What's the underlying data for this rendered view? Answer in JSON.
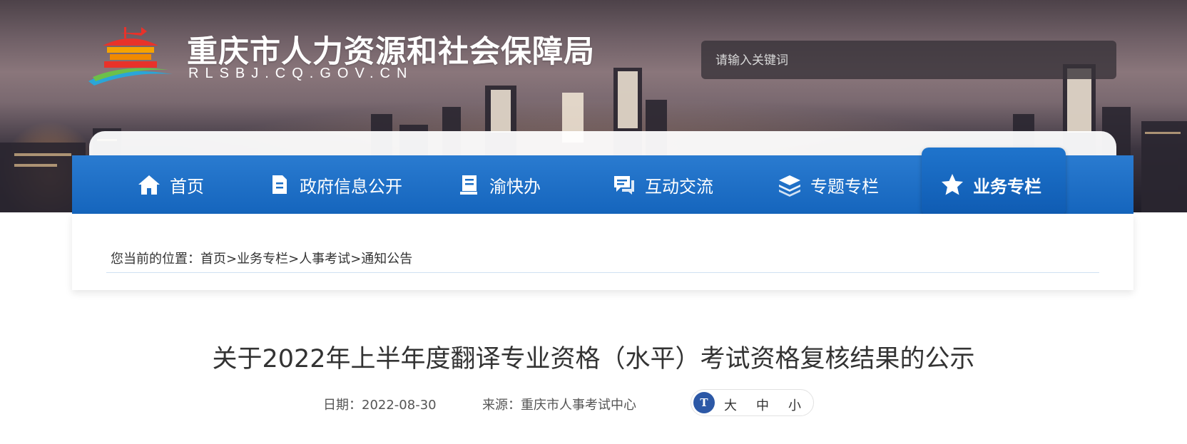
{
  "header": {
    "site_title": "重庆市人力资源和社会保障局",
    "site_domain": "RLSBJ.CQ.GOV.CN",
    "search_placeholder": "请输入关键词"
  },
  "nav": {
    "items": [
      {
        "label": "首页",
        "icon": "home-icon"
      },
      {
        "label": "政府信息公开",
        "icon": "document-icon"
      },
      {
        "label": "渝快办",
        "icon": "book-icon"
      },
      {
        "label": "互动交流",
        "icon": "chat-icon"
      },
      {
        "label": "专题专栏",
        "icon": "layers-icon"
      },
      {
        "label": "业务专栏",
        "icon": "star-icon",
        "active": true
      }
    ]
  },
  "breadcrumb": {
    "prefix": "您当前的位置：",
    "items": [
      "首页",
      "业务专栏",
      "人事考试",
      "通知公告"
    ],
    "separator": ">"
  },
  "article": {
    "title": "关于2022年上半年度翻译专业资格（水平）考试资格复核结果的公示",
    "date_label": "日期：",
    "date": "2022-08-30",
    "source_label": "来源：",
    "source": "重庆市人事考试中心"
  },
  "font_size": {
    "icon": "text-size-icon",
    "icon_text": "T",
    "large": "大",
    "medium": "中",
    "small": "小"
  },
  "colors": {
    "nav_blue": "#1a6dc5",
    "text": "#333333"
  }
}
